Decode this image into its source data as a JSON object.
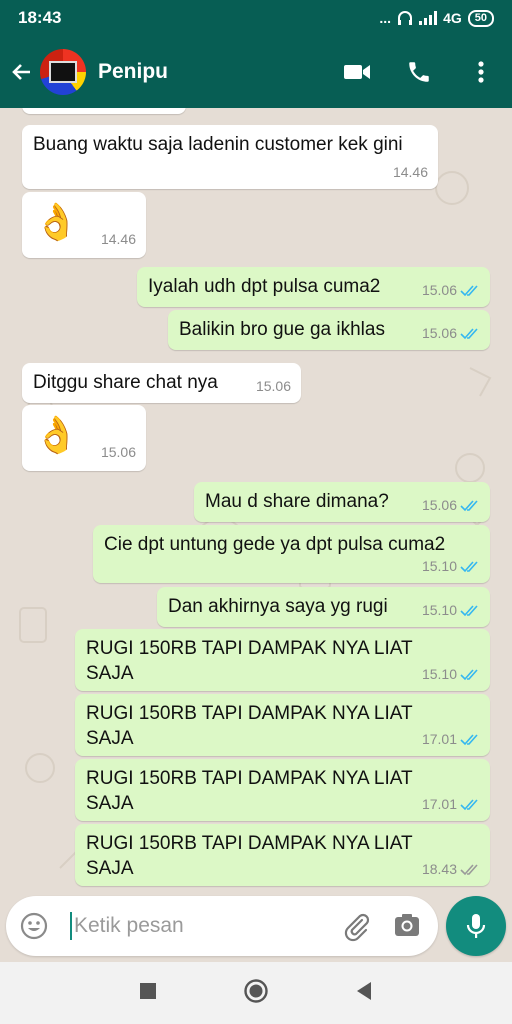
{
  "status_bar": {
    "time": "18:43",
    "dots": "...",
    "network": "4G",
    "battery": "50"
  },
  "header": {
    "contact_name": "Penipu"
  },
  "messages": [
    {
      "dir": "in",
      "text": "Buang waktu saja ladenin customer kek gini",
      "time": "14.46"
    },
    {
      "dir": "in",
      "text": "👌",
      "time": "14.46"
    },
    {
      "dir": "out",
      "text": "Iyalah udh dpt pulsa cuma2",
      "time": "15.06"
    },
    {
      "dir": "out",
      "text": "Balikin bro gue ga ikhlas",
      "time": "15.06"
    },
    {
      "dir": "in",
      "text": "Ditggu share chat nya",
      "time": "15.06"
    },
    {
      "dir": "in",
      "text": "👌",
      "time": "15.06"
    },
    {
      "dir": "out",
      "text": "Mau d share dimana?",
      "time": "15.06"
    },
    {
      "dir": "out",
      "text": "Cie dpt untung gede ya dpt pulsa cuma2",
      "time": "15.10"
    },
    {
      "dir": "out",
      "text": "Dan akhirnya saya yg rugi",
      "time": "15.10"
    },
    {
      "dir": "out",
      "text": "RUGI 150RB TAPI DAMPAK NYA LIAT SAJA",
      "time": "15.10"
    },
    {
      "dir": "out",
      "text": "RUGI 150RB TAPI DAMPAK NYA LIAT SAJA",
      "time": "17.01"
    },
    {
      "dir": "out",
      "text": "RUGI 150RB TAPI DAMPAK NYA LIAT SAJA",
      "time": "17.01"
    },
    {
      "dir": "out",
      "text": "RUGI 150RB TAPI DAMPAK NYA LIAT SAJA",
      "time": "18.43"
    }
  ],
  "read_receipts": [
    "read",
    "read",
    "read",
    "read",
    "read",
    "read",
    "read",
    "read",
    "delivered"
  ],
  "composer": {
    "placeholder": "Ketik pesan"
  },
  "colors": {
    "header": "#075e54",
    "accent": "#128c7e",
    "outgoing_bubble": "#dcf8c6",
    "chat_bg": "#e5ddd5",
    "read_tick": "#34b7f1"
  },
  "icons": [
    "back-arrow-icon",
    "video-call-icon",
    "voice-call-icon",
    "more-options-icon",
    "emoji-icon",
    "attach-icon",
    "camera-icon",
    "mic-icon",
    "nav-recents-icon",
    "nav-home-icon",
    "nav-back-icon"
  ]
}
